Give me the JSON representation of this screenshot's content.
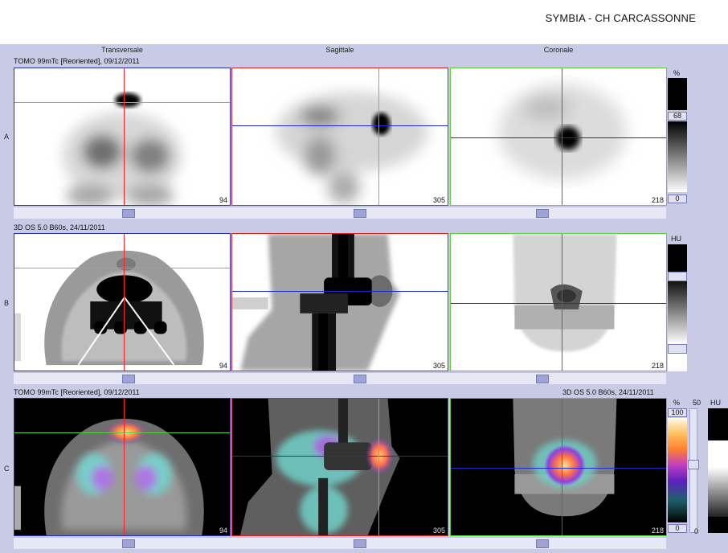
{
  "header": {
    "hospital": "SYMBIA - CH CARCASSONNE"
  },
  "columns": [
    "Transversale",
    "Sagittale",
    "Coronale"
  ],
  "rows": [
    {
      "letter": "A",
      "info_left": "TOMO 99mTc [Reoriented], 09/12/2011",
      "info_right": ""
    },
    {
      "letter": "B",
      "info_left": "3D  OS  5.0  B60s, 24/11/2011",
      "info_right": ""
    },
    {
      "letter": "C",
      "info_left": "TOMO 99mTc [Reoriented], 09/12/2011",
      "info_right": "3D  OS  5.0  B60s, 24/11/2011"
    }
  ],
  "slices": [
    "94",
    "305",
    "218"
  ],
  "scale_a": {
    "unit": "%",
    "upper": "68",
    "lower": "0"
  },
  "scale_b": {
    "unit": "HU"
  },
  "scale_c": {
    "unit_pct": "%",
    "max": "100",
    "min": "0",
    "mid_label": "50",
    "unit_hu": "HU",
    "bottom_label": "0"
  },
  "colors": {
    "crosshair_vertical": "#ff2020",
    "crosshair_horizontal_red_frame": "#1a2ccc",
    "frame_transverse": "#2030c0",
    "frame_sagittal": "#e02020",
    "frame_coronal": "#60d040"
  }
}
